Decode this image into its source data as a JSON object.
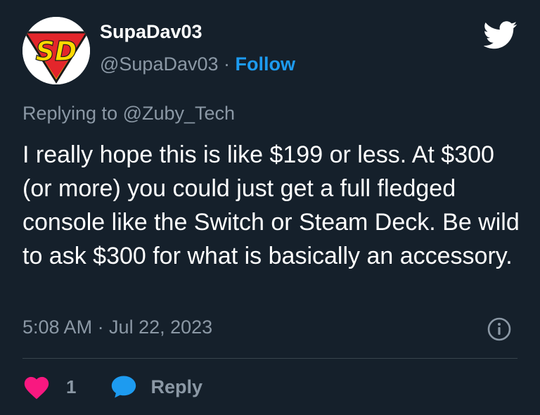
{
  "author": {
    "display_name": "SupaDav03",
    "handle": "@SupaDav03",
    "separator": "·",
    "follow_label": "Follow",
    "avatar_text": "SD"
  },
  "replying_to": "Replying to @Zuby_Tech",
  "tweet": {
    "text": "I really hope this is like $199 or less. At $300 (or more) you could just get a full fledged console like the Switch or Steam Deck. Be wild to ask $300 for what is basically an accessory.",
    "timestamp": "5:08 AM · Jul 22, 2023"
  },
  "actions": {
    "like_count": "1",
    "reply_label": "Reply"
  },
  "icons": {
    "brand": "twitter-bird-icon",
    "info": "info-icon",
    "like": "heart-icon",
    "reply": "speech-bubble-icon"
  },
  "colors": {
    "background": "#15202b",
    "accent": "#1d9bf0",
    "secondary_text": "#8b98a5",
    "like": "#f91880",
    "divider": "#38444d"
  }
}
